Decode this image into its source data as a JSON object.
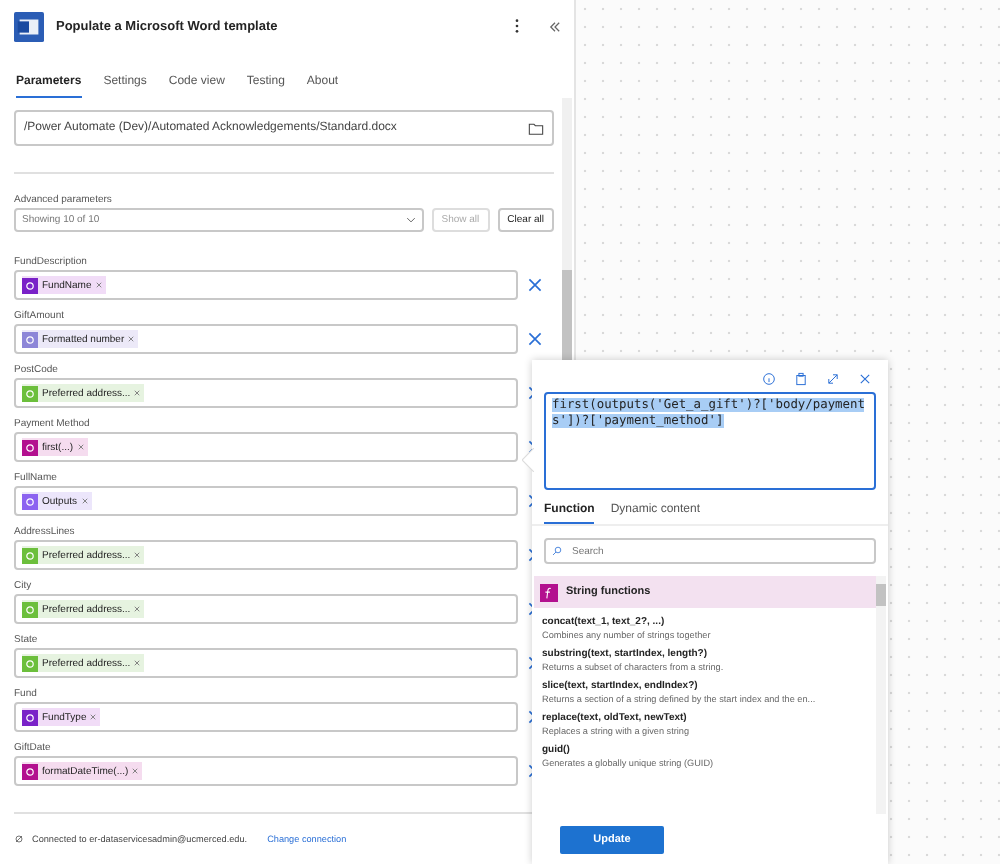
{
  "header": {
    "title": "Populate a Microsoft Word template"
  },
  "tabs": [
    {
      "label": "Parameters",
      "selected": true
    },
    {
      "label": "Settings",
      "selected": false
    },
    {
      "label": "Code view",
      "selected": false
    },
    {
      "label": "Testing",
      "selected": false
    },
    {
      "label": "About",
      "selected": false
    }
  ],
  "file_field": {
    "value": "/Power Automate (Dev)/Automated Acknowledgements/Standard.docx"
  },
  "advanced": {
    "label": "Advanced parameters",
    "dropdown": "Showing 10 of 10",
    "show_all": {
      "label": "Show all",
      "disabled": true
    },
    "clear_all": {
      "label": "Clear all",
      "disabled": false
    }
  },
  "parameters": [
    {
      "label": "FundDescription",
      "token": {
        "kind": "variable",
        "text": "FundName"
      }
    },
    {
      "label": "GiftAmount",
      "token": {
        "kind": "number",
        "text": "Formatted number"
      }
    },
    {
      "label": "PostCode",
      "token": {
        "kind": "location",
        "text": "Preferred address..."
      }
    },
    {
      "label": "Payment Method",
      "token": {
        "kind": "function",
        "text": "first(...)"
      }
    },
    {
      "label": "FullName",
      "token": {
        "kind": "outputs",
        "text": "Outputs"
      }
    },
    {
      "label": "AddressLines",
      "token": {
        "kind": "location",
        "text": "Preferred address..."
      }
    },
    {
      "label": "City",
      "token": {
        "kind": "location",
        "text": "Preferred address..."
      }
    },
    {
      "label": "State",
      "token": {
        "kind": "location",
        "text": "Preferred address..."
      }
    },
    {
      "label": "Fund",
      "token": {
        "kind": "variable",
        "text": "FundType"
      }
    },
    {
      "label": "GiftDate",
      "token": {
        "kind": "function",
        "text": "formatDateTime(...)"
      }
    }
  ],
  "footer": {
    "connection": "Connected to er-dataservicesadmin@ucmerced.edu.",
    "link": "Change connection"
  },
  "expression_editor": {
    "expression": "first(outputs('Get_a_gift')?['body/payments'])?['payment_method']",
    "tabs": [
      {
        "label": "Function",
        "selected": true
      },
      {
        "label": "Dynamic content",
        "selected": false
      }
    ],
    "search": {
      "placeholder": "Search"
    },
    "category": "String functions",
    "functions": [
      {
        "signature": "concat(text_1, text_2?, ...)",
        "description": "Combines any number of strings together"
      },
      {
        "signature": "substring(text, startIndex, length?)",
        "description": "Returns a subset of characters from a string."
      },
      {
        "signature": "slice(text, startIndex, endIndex?)",
        "description": "Returns a section of a string defined by the start index and the en..."
      },
      {
        "signature": "replace(text, oldText, newText)",
        "description": "Replaces a string with a given string"
      },
      {
        "signature": "guid()",
        "description": "Generates a globally unique string (GUID)"
      }
    ],
    "update_button": "Update"
  }
}
